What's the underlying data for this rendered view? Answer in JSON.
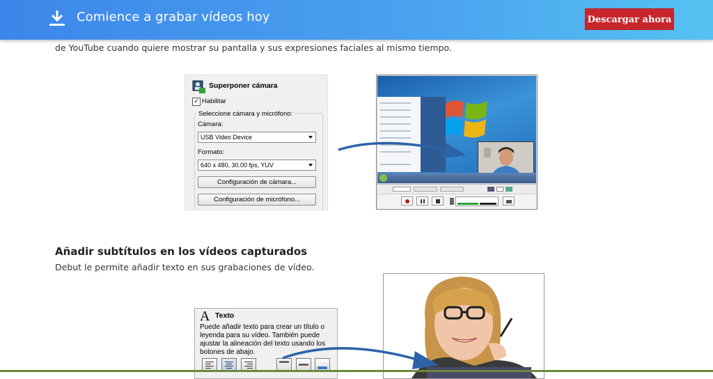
{
  "banner": {
    "title": "Comience a grabar vídeos hoy",
    "download_label": "Descargar ahora",
    "icon": "download-icon",
    "colors": {
      "gradient_start": "#3d86ea",
      "gradient_end": "#56c2f2",
      "button": "#c9262c"
    }
  },
  "section1": {
    "paragraph_tail": "de YouTube cuando quiere mostrar su pantalla y sus expresiones faciales al mismo tiempo."
  },
  "camera_panel": {
    "title": "Superponer cámara",
    "enable_label": "Habilitar",
    "enable_checked": true,
    "check_mark": "✓",
    "group_label": "Seleccione cámara y micrófono:",
    "camera_label": "Cámara:",
    "camera_value": "USB Video Device",
    "format_label": "Formato:",
    "format_value": "640 x 480, 30.00 fps, YUV",
    "camera_settings_button": "Configuración de cámara...",
    "mic_settings_button": "Configuración de micrófono..."
  },
  "section2": {
    "heading": "Añadir subtítulos en los vídeos capturados",
    "paragraph": "Debut le permite añadir texto en sus grabaciones de vídeo."
  },
  "text_panel": {
    "icon_letter": "A",
    "title": "Texto",
    "description": "Puede añadir texto para crear un título o leyenda para su vídeo. También puede ajustar la alineación del texto usando los botones de abajo."
  }
}
